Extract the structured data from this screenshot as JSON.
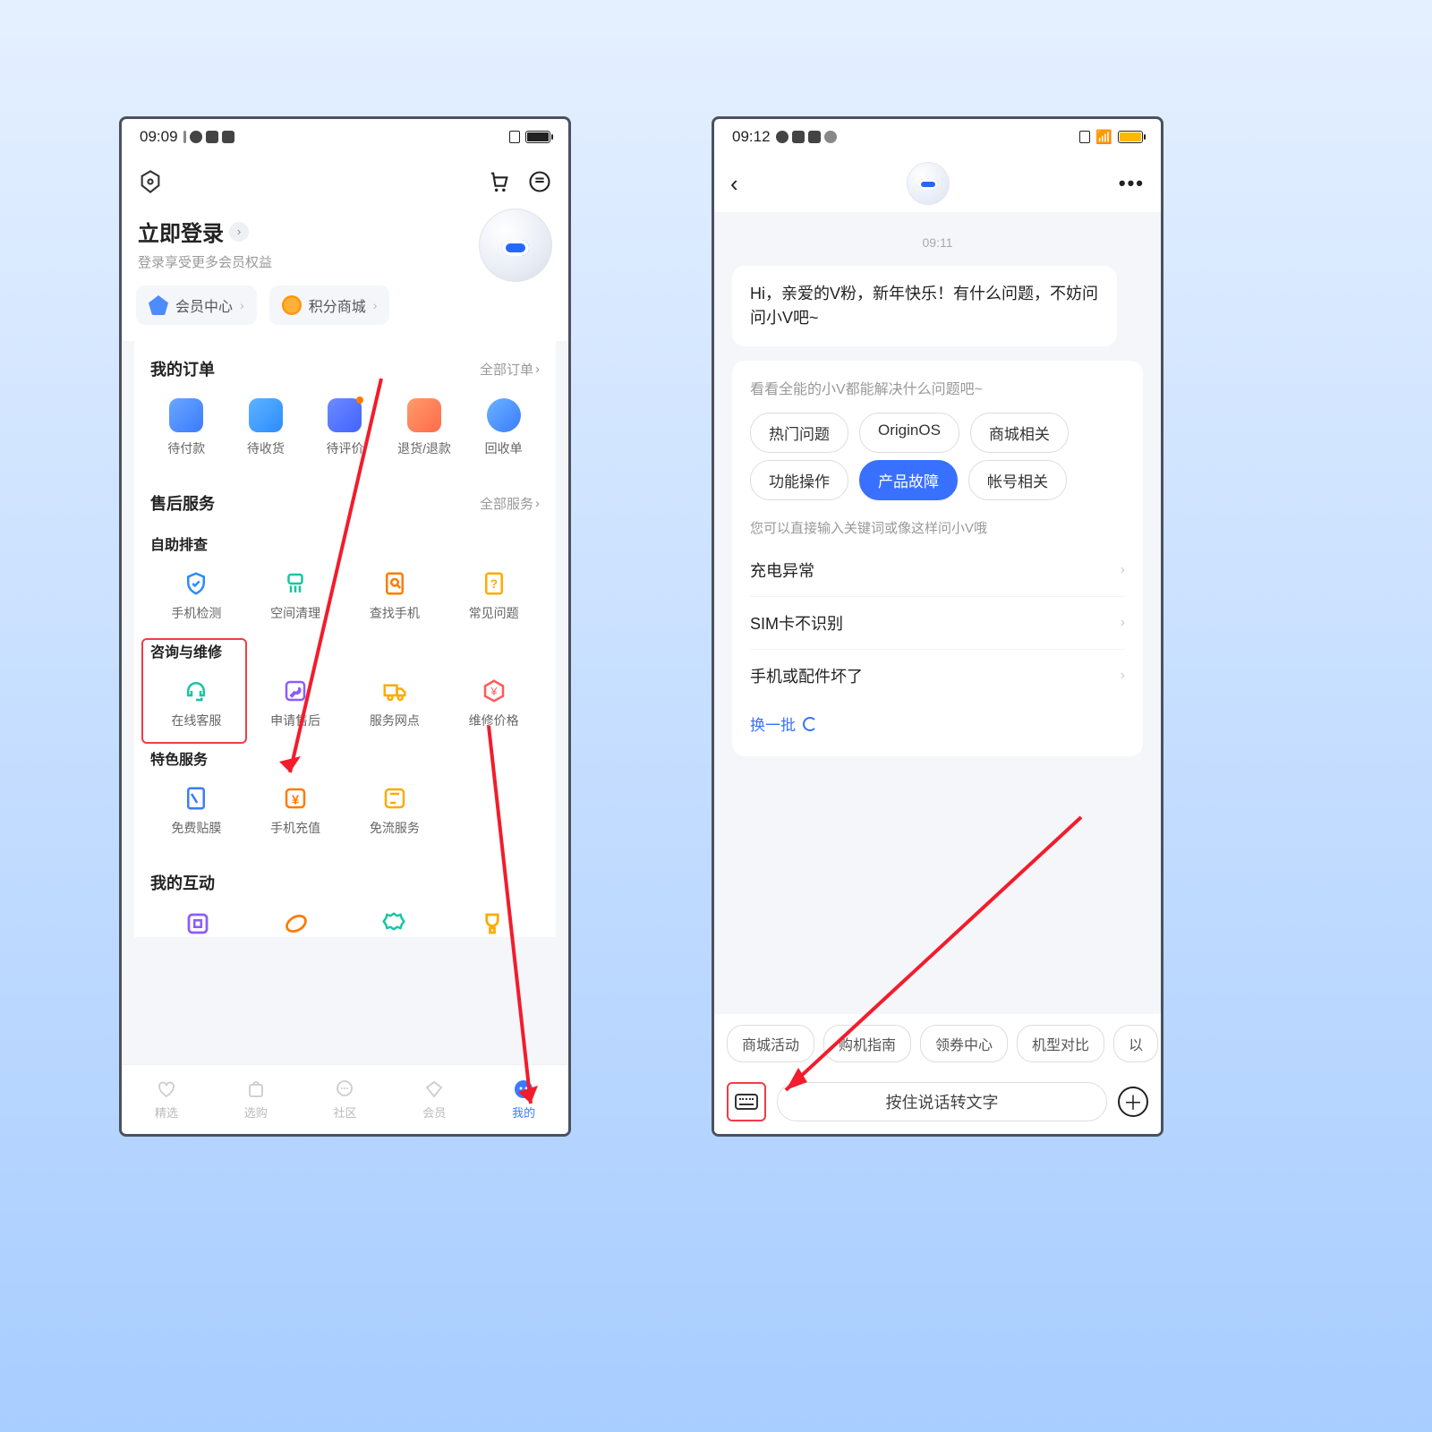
{
  "left": {
    "status": {
      "time": "09:09"
    },
    "login": {
      "title": "立即登录",
      "sub": "登录享受更多会员权益"
    },
    "chips": {
      "member": "会员中心",
      "points": "积分商城"
    },
    "orders": {
      "title": "我的订单",
      "all": "全部订单",
      "items": [
        "待付款",
        "待收货",
        "待评价",
        "退货/退款",
        "回收单"
      ]
    },
    "service": {
      "title": "售后服务",
      "all": "全部服务",
      "g1_title": "自助排查",
      "g1": [
        "手机检测",
        "空间清理",
        "查找手机",
        "常见问题"
      ],
      "g2_title": "咨询与维修",
      "g2": [
        "在线客服",
        "申请售后",
        "服务网点",
        "维修价格"
      ],
      "g3_title": "特色服务",
      "g3": [
        "免费贴膜",
        "手机充值",
        "免流服务"
      ]
    },
    "interact": {
      "title": "我的互动"
    },
    "nav": [
      "精选",
      "选购",
      "社区",
      "会员",
      "我的"
    ]
  },
  "right": {
    "status": {
      "time": "09:12"
    },
    "chat": {
      "time": "09:11",
      "greeting": "Hi，亲爱的V粉，新年快乐！有什么问题，不妨问问小V吧~",
      "hint1": "看看全能的小V都能解决什么问题吧~",
      "pills": [
        "热门问题",
        "OriginOS",
        "商城相关",
        "功能操作",
        "产品故障",
        "帐号相关"
      ],
      "active_pill_index": 4,
      "hint2": "您可以直接输入关键词或像这样问小V哦",
      "qs": [
        "充电异常",
        "SIM卡不识别",
        "手机或配件坏了"
      ],
      "refresh": "换一批"
    },
    "suggestions": [
      "商城活动",
      "购机指南",
      "领券中心",
      "机型对比",
      "以"
    ],
    "input": {
      "placeholder": "按住说话转文字"
    }
  }
}
